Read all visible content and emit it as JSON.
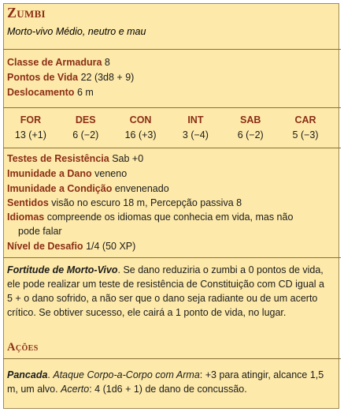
{
  "monster": {
    "name": "Zumbi",
    "subtitle": "Morto-vivo Médio, neutro e mau"
  },
  "defense": {
    "armor_label": "Classe de Armadura",
    "armor_value": "8",
    "hp_label": "Pontos de Vida",
    "hp_value": "22 (3d8 + 9)",
    "speed_label": "Deslocamento",
    "speed_value": "6 m"
  },
  "abilities": [
    {
      "name": "FOR",
      "value": "13 (+1)"
    },
    {
      "name": "DES",
      "value": "6 (−2)"
    },
    {
      "name": "CON",
      "value": "16 (+3)"
    },
    {
      "name": "INT",
      "value": "3 (−4)"
    },
    {
      "name": "SAB",
      "value": "6 (−2)"
    },
    {
      "name": "CAR",
      "value": "5 (−3)"
    }
  ],
  "traits": {
    "saves_label": "Testes de Resistência",
    "saves_value": "Sab +0",
    "dmg_imm_label": "Imunidade a Dano",
    "dmg_imm_value": "veneno",
    "cond_imm_label": "Imunidade a Condição",
    "cond_imm_value": "envenenado",
    "senses_label": "Sentidos",
    "senses_value": "visão no escuro 18 m, Percepção passiva 8",
    "languages_label": "Idiomas",
    "languages_value_1": "compreende os idiomas que conhecia em vida, mas não",
    "languages_value_2": "pode falar",
    "challenge_label": "Nível de Desafio",
    "challenge_value": "1/4 (50 XP)"
  },
  "feature": {
    "name": "Fortitude de Morto-Vivo",
    "text": ". Se dano reduziria o zumbi a 0 pontos de vida, ele pode realizar um teste de resistência de Constituição com CD igual a 5 + o dano sofrido, a não ser que o dano seja radiante ou de um acerto crítico. Se obtiver sucesso, ele cairá a 1 ponto de vida, no lugar."
  },
  "actions": {
    "title": "Ações",
    "name": "Pancada",
    "dot": ". ",
    "attack_type": "Ataque Corpo-a-Corpo com Arma",
    "attack_text": ": +3 para atingir, alcance 1,5 m, um alvo. ",
    "hit_label": "Acerto",
    "hit_text": ": 4 (1d6 + 1) de dano de concussão."
  }
}
